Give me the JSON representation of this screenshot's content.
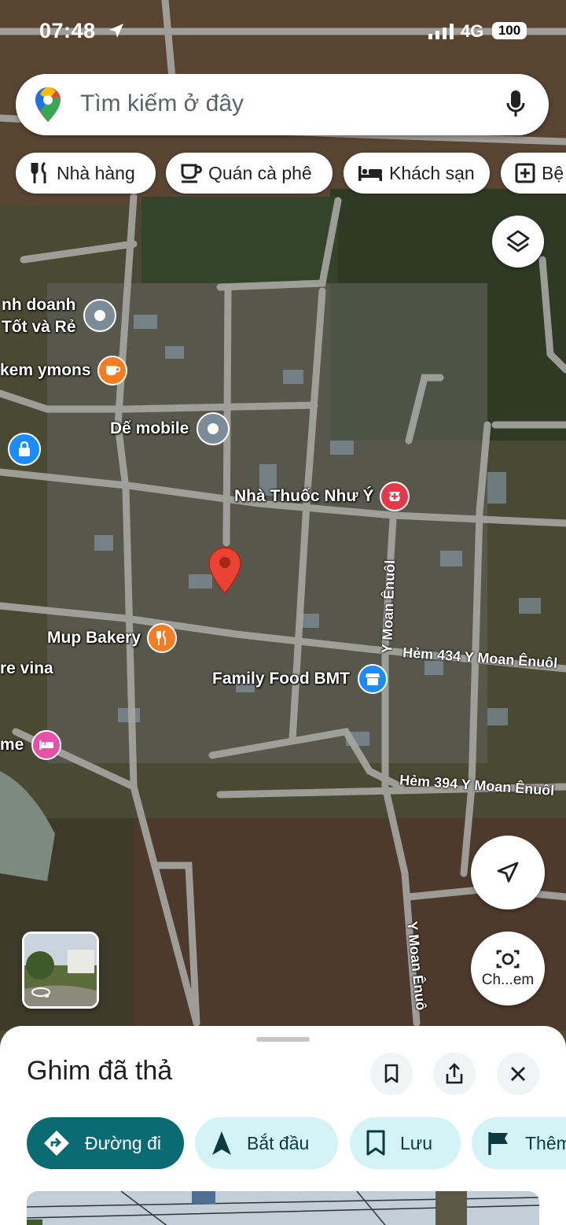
{
  "status_bar": {
    "time": "07:48",
    "network": "4G",
    "battery": "100"
  },
  "search": {
    "placeholder": "Tìm kiếm ở đây"
  },
  "chips": [
    {
      "label": "Nhà hàng",
      "icon": "fork-knife-icon"
    },
    {
      "label": "Quán cà phê",
      "icon": "coffee-cup-icon"
    },
    {
      "label": "Khách sạn",
      "icon": "bed-icon"
    },
    {
      "label": "Bệ",
      "icon": "hospital-plus-icon"
    }
  ],
  "map": {
    "pois": [
      {
        "label": "nh doanh",
        "icon": "place-marker-icon"
      },
      {
        "label": "Tốt và Rẻ",
        "icon": "none"
      },
      {
        "label": "kem ymons",
        "icon": "cafe-icon"
      },
      {
        "label": "Dế mobile",
        "icon": "place-marker-icon"
      },
      {
        "label": "Nhà Thuốc Như Ý",
        "icon": "pharmacy-icon"
      },
      {
        "label": "Mup Bakery",
        "icon": "restaurant-icon"
      },
      {
        "label": "re vina",
        "icon": "none"
      },
      {
        "label": "Family Food BMT",
        "icon": "store-icon"
      },
      {
        "label": "me",
        "icon": "hotel-icon"
      }
    ],
    "streets": [
      "Y Moan Ênuôl",
      "Hẻm 434 Y Moan Ênuôl",
      "Hẻm 394 Y Moan Ênuôl",
      "Y Moan Ênuô"
    ],
    "lens_label": "Ch...em",
    "colors": {
      "pin": "#ea4335",
      "cafe": "#f57c20",
      "restaurant": "#f57c20",
      "pharmacy": "#e5394a",
      "store": "#1a8cff",
      "hotel": "#e94fa8",
      "generic": "#7b8b98",
      "lock": "#1a8cff"
    }
  },
  "sheet": {
    "title": "Ghim đã thả",
    "actions": [
      {
        "label": "Đường đi",
        "icon": "directions-icon"
      },
      {
        "label": "Bắt đầu",
        "icon": "navigation-arrow-icon"
      },
      {
        "label": "Lưu",
        "icon": "bookmark-icon"
      },
      {
        "label": "Thêm",
        "icon": "flag-icon"
      }
    ],
    "colors": {
      "primary": "#0b6b73",
      "secondary": "#d4f3f6"
    }
  }
}
